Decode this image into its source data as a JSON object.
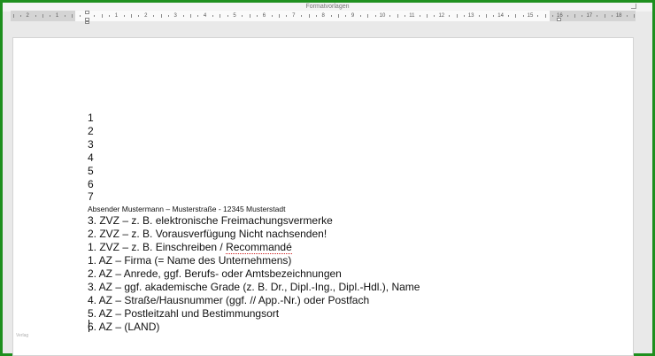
{
  "app": {
    "ribbon_label": "Formatvorlagen"
  },
  "ruler": {
    "left_labels": [
      "2",
      "1"
    ],
    "right_labels": [
      "1",
      "2",
      "3",
      "4",
      "5",
      "6",
      "7",
      "8",
      "9",
      "10",
      "11",
      "12",
      "13",
      "14",
      "15",
      "16",
      "17",
      "18"
    ]
  },
  "page": {
    "margin_marker": "Verlag",
    "lines": [
      {
        "text": "1",
        "size": "big"
      },
      {
        "text": "2",
        "size": "big"
      },
      {
        "text": "3",
        "size": "big"
      },
      {
        "text": "4",
        "size": "big"
      },
      {
        "text": "5",
        "size": "big"
      },
      {
        "text": "6",
        "size": "big"
      },
      {
        "text": "7",
        "size": "big"
      },
      {
        "text": "Absender Mustermann – Musterstraße - 12345 Musterstadt",
        "size": "small"
      },
      {
        "text": "3. ZVZ – z. B. elektronische Freimachungsvermerke",
        "size": "big"
      },
      {
        "text": "2. ZVZ – z. B. Vorausverfügung Nicht nachsenden!",
        "size": "big"
      },
      {
        "text": "1. ZVZ – z. B. Einschreiben / ",
        "size": "big",
        "squiggle": "Recommandé"
      },
      {
        "text": "1. AZ – Firma (= Name des Unternehmens)",
        "size": "big"
      },
      {
        "text": "2. AZ – Anrede, ggf. Berufs- oder Amtsbezeichnungen",
        "size": "big"
      },
      {
        "text": "3. AZ – ggf. akademische Grade (z. B. Dr., Dipl.-Ing., Dipl.-Hdl.), Name",
        "size": "big"
      },
      {
        "text": "4. AZ – Straße/Hausnummer (ggf. // App.-Nr.) oder Postfach",
        "size": "big"
      },
      {
        "text": "5. AZ – Postleitzahl und Bestimmungsort",
        "size": "big"
      },
      {
        "text": "6. AZ – (LAND)",
        "size": "big"
      }
    ]
  },
  "colors": {
    "frame": "#1e8f1e",
    "spelling_underline": "#d02020"
  }
}
